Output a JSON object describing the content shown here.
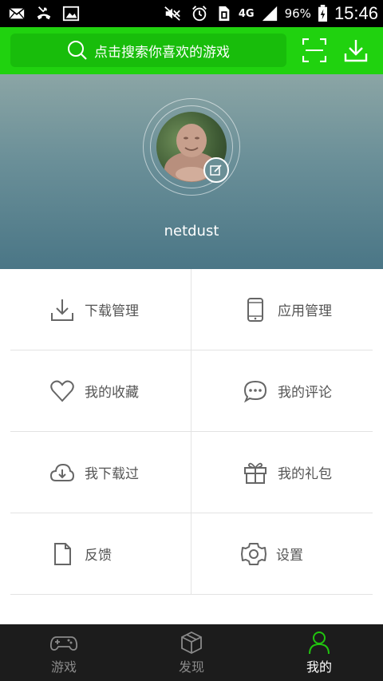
{
  "status_bar": {
    "left_icons": [
      "mail-icon",
      "missed-call-icon",
      "image-icon"
    ],
    "right_icons": [
      "mute-icon",
      "alarm-icon",
      "sim-icon",
      "network-4g-icon",
      "signal-icon",
      "battery-charging-icon"
    ],
    "network": "4G",
    "battery": "96%",
    "time": "15:46"
  },
  "topbar": {
    "search_placeholder": "点击搜索你喜欢的游戏",
    "scan_icon": "scan-icon",
    "download_icon": "download-icon",
    "background": "#20d20f"
  },
  "profile": {
    "username": "netdust",
    "edit_icon": "edit-icon"
  },
  "menu": [
    {
      "label": "下载管理",
      "icon": "download-icon"
    },
    {
      "label": "应用管理",
      "icon": "phone-icon"
    },
    {
      "label": "我的收藏",
      "icon": "heart-icon"
    },
    {
      "label": "我的评论",
      "icon": "comment-icon"
    },
    {
      "label": "我下载过",
      "icon": "cloud-download-icon"
    },
    {
      "label": "我的礼包",
      "icon": "gift-icon"
    },
    {
      "label": "反馈",
      "icon": "document-icon"
    },
    {
      "label": "设置",
      "icon": "gear-icon"
    }
  ],
  "bottom_nav": [
    {
      "label": "游戏",
      "icon": "gamepad-icon",
      "active": false
    },
    {
      "label": "发现",
      "icon": "cube-icon",
      "active": false
    },
    {
      "label": "我的",
      "icon": "person-icon",
      "active": true
    }
  ],
  "colors": {
    "accent": "#20d20f",
    "active_icon": "#21c40f",
    "nav_bg": "#1c1c1c"
  }
}
